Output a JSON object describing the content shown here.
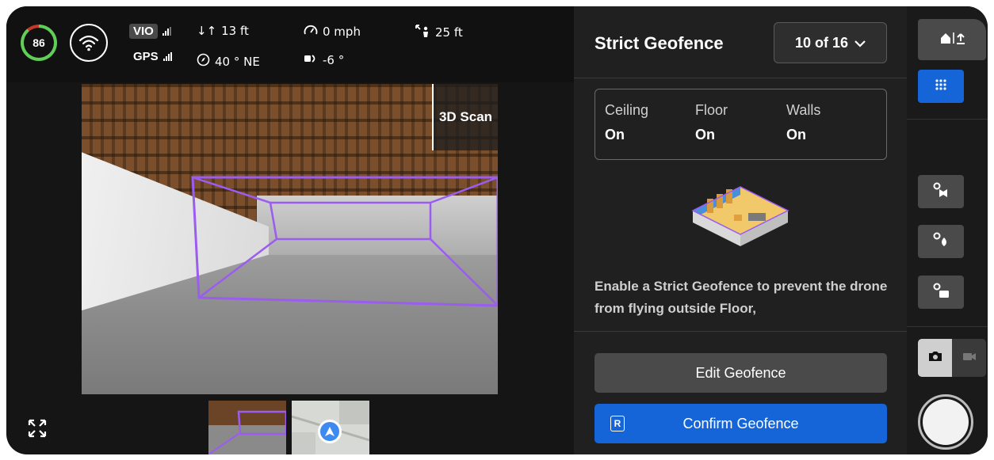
{
  "telemetry": {
    "battery": "86",
    "vio_label": "VIO",
    "gps_label": "GPS",
    "altitude": "13 ft",
    "heading": "40 ° NE",
    "speed": "0 mph",
    "gimbal_angle": "-6 °",
    "distance": "25 ft"
  },
  "camera": {
    "overlay_label": "3D Scan"
  },
  "panel": {
    "title": "Strict Geofence",
    "page_selector": "10 of 16",
    "status": [
      {
        "label": "Ceiling",
        "value": "On"
      },
      {
        "label": "Floor",
        "value": "On"
      },
      {
        "label": "Walls",
        "value": "On"
      }
    ],
    "description": "Enable a Strict Geofence to prevent the drone from flying outside Floor,",
    "edit_button": "Edit Geofence",
    "confirm_button": "Confirm Geofence",
    "confirm_key": "R"
  },
  "rail": {
    "icons": [
      "home-return-icon",
      "grid-menu-icon",
      "gear-map-icon",
      "gear-fire-icon",
      "gear-camera-icon"
    ],
    "mode": [
      "photo",
      "video"
    ],
    "active_mode": "photo"
  },
  "colors": {
    "accent_blue": "#1565d8",
    "geofence_purple": "#9b5cf0",
    "battery_green": "#5fcf55"
  }
}
